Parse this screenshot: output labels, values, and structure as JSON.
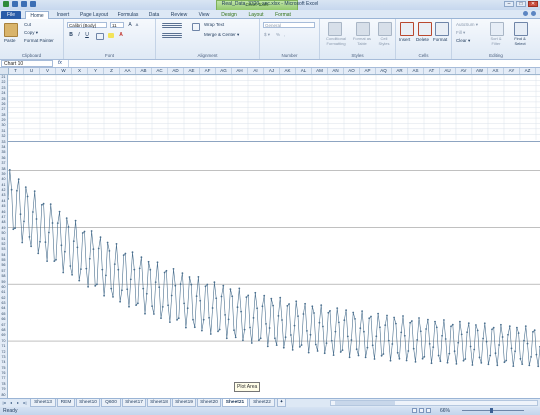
{
  "window": {
    "title": "Real_Data_3320_sec.xlsx - Microsoft Excel",
    "chart_tools_label": "Chart Tools",
    "controls": [
      "–",
      "□",
      "✕"
    ]
  },
  "tabs": [
    "File",
    "Home",
    "Insert",
    "Page Layout",
    "Formulas",
    "Data",
    "Review",
    "View",
    "Design",
    "Layout",
    "Format"
  ],
  "ribbon": {
    "clipboard": {
      "paste": "Paste",
      "cut": "Cut",
      "copy": "Copy ▾",
      "format_painter": "Format Painter",
      "label": "Clipboard"
    },
    "font": {
      "name": "Calibri (Body)",
      "size": "11",
      "label": "Font",
      "bold": "B",
      "italic": "I",
      "underline": "U",
      "grow": "A",
      "shrink": "A",
      "font_color": "A"
    },
    "alignment": {
      "wrap": "Wrap Text",
      "merge": "Merge & Center ▾",
      "label": "Alignment"
    },
    "number": {
      "format": "General",
      "currency": "$ ▾",
      "percent": "%",
      "comma": ",",
      "label": "Number"
    },
    "styles": {
      "conditional": "Conditional Formatting",
      "table": "Format as Table",
      "cell": "Cell Styles",
      "label": "Styles"
    },
    "cells": {
      "insert": "Insert",
      "delete": "Delete",
      "format": "Format",
      "label": "Cells"
    },
    "editing": {
      "autosum": "AutoSum ▾",
      "fill": "Fill ▾",
      "clear": "Clear ▾",
      "sort": "Sort & Filter",
      "find": "Find & Select",
      "label": "Editing"
    }
  },
  "formula_bar": {
    "name_box": "Chart 10",
    "fx": "fx",
    "value": ""
  },
  "columns": [
    "T",
    "U",
    "V",
    "W",
    "X",
    "Y",
    "Z",
    "AA",
    "AB",
    "AC",
    "AD",
    "AE",
    "AF",
    "AG",
    "AH",
    "AI",
    "AJ",
    "AK",
    "AL",
    "AM",
    "AN",
    "AO",
    "AP",
    "AQ",
    "AR",
    "AS",
    "AT",
    "AU",
    "AV",
    "AW",
    "AX",
    "AY",
    "AZ"
  ],
  "rows_top": [
    21,
    22,
    23,
    24,
    25,
    26,
    27,
    28,
    29,
    30,
    31
  ],
  "rows_chart": [
    32,
    33,
    34,
    35,
    36,
    37,
    38,
    39,
    40,
    41,
    42,
    43,
    44,
    45,
    46,
    47,
    48,
    49,
    50,
    51,
    52,
    53,
    54,
    55,
    56,
    57,
    58,
    59,
    60,
    61,
    62,
    63,
    64,
    65,
    66,
    67,
    68,
    69,
    70,
    71,
    72,
    73,
    74,
    75,
    76,
    77,
    78,
    79,
    80
  ],
  "chart_data": {
    "type": "line",
    "title": "",
    "x_range": [
      0,
      300
    ],
    "y_range_visible": [
      0.55,
      1.0
    ],
    "series": [
      {
        "name": "",
        "center_start": 0.9,
        "center_end": 0.64,
        "amplitude_start": 0.055,
        "amplitude_end": 0.035,
        "period": 4.6,
        "points": 300,
        "color": "#4a6f8e"
      }
    ],
    "gridline_levels": [
      0.95,
      0.85,
      0.75,
      0.65
    ],
    "tooltip": "Plot Area"
  },
  "sheet_tabs": [
    "Sheet13",
    "REM",
    "Sheet10",
    "Q600",
    "Sheet17",
    "Sheet18",
    "Sheet19",
    "Sheet20",
    "Sheet21",
    "Sheet22"
  ],
  "active_sheet": "Sheet21",
  "status": {
    "text": "Ready",
    "zoom": "66%"
  }
}
